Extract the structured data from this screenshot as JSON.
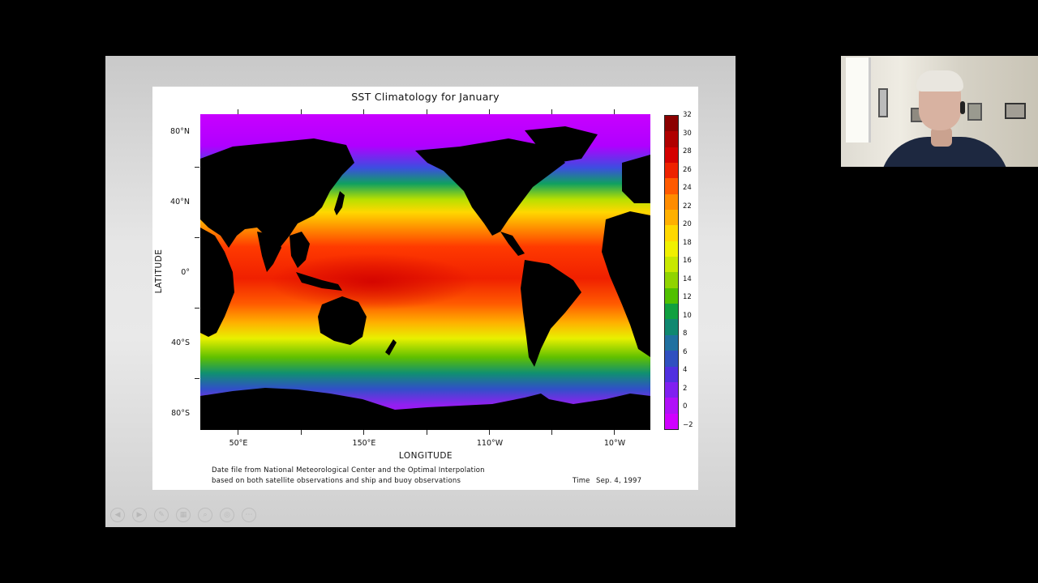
{
  "slide": {
    "title": "SST Climatology for January",
    "latitude_labels": [
      "80°N",
      "40°N",
      "0°",
      "40°S",
      "80°S"
    ],
    "longitude_labels": [
      "50°E",
      "150°E",
      "110°W",
      "10°W"
    ],
    "x_axis_title": "LONGITUDE",
    "y_axis_title": "LATITUDE",
    "colorbar_labels": [
      "32",
      "30",
      "28",
      "26",
      "24",
      "22",
      "20",
      "18",
      "16",
      "14",
      "12",
      "10",
      "8",
      "6",
      "4",
      "2",
      "0",
      "−2"
    ],
    "colorbar_colors": [
      "#8b0000",
      "#b00000",
      "#d40000",
      "#ee2200",
      "#ff5a00",
      "#ff8c00",
      "#ffb000",
      "#ffd800",
      "#f0f000",
      "#c8e800",
      "#90d400",
      "#50c000",
      "#10a040",
      "#108870",
      "#2070a0",
      "#3050c0",
      "#5030e0",
      "#8020f0",
      "#b010f8",
      "#d000ff"
    ],
    "note_line1": "Date file from National Meteorological Center and the Optimal Interpolation",
    "note_line2": "based on both satellite observations and ship and buoy observations",
    "time_label": "Time",
    "time_value": "Sep. 4, 1997"
  },
  "toolbar": {
    "buttons": [
      {
        "name": "previous-slide-button",
        "icon": "◀"
      },
      {
        "name": "next-slide-button",
        "icon": "▶"
      },
      {
        "name": "pen-tool-button",
        "icon": "✎"
      },
      {
        "name": "slides-view-button",
        "icon": "▦"
      },
      {
        "name": "zoom-button",
        "icon": "⌕"
      },
      {
        "name": "pointer-button",
        "icon": "◎"
      },
      {
        "name": "more-options-button",
        "icon": "⋯"
      }
    ]
  }
}
